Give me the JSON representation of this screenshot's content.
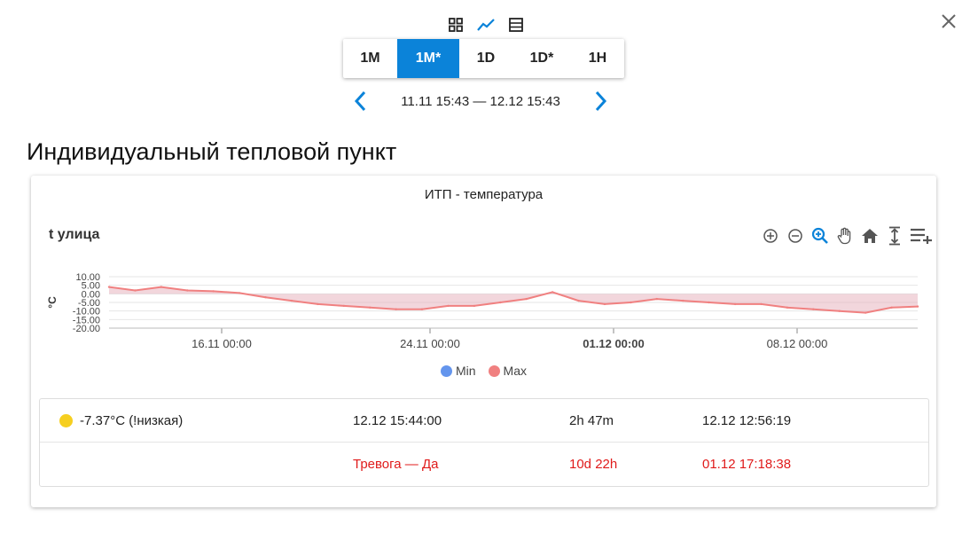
{
  "view_icons": [
    "grid-icon",
    "chart-line-icon",
    "table-icon"
  ],
  "colors": {
    "accent": "#0b83d9",
    "max_series": "#f08080",
    "min_series": "#6495ed",
    "alarm": "#e01b1b",
    "sun": "#f6cf20"
  },
  "period_tabs": [
    {
      "label": "1M",
      "active": false
    },
    {
      "label": "1M*",
      "active": true
    },
    {
      "label": "1D",
      "active": false
    },
    {
      "label": "1D*",
      "active": false
    },
    {
      "label": "1H",
      "active": false
    }
  ],
  "range": {
    "text": "11.11 15:43 — 12.12 15:43"
  },
  "section": {
    "title": "Индивидуальный тепловой пункт"
  },
  "chart": {
    "title": "ИТП - температура",
    "series_label": "t улица",
    "toolbar_icons": [
      "zoom-in-icon",
      "zoom-out-icon",
      "zoom-select-icon",
      "pan-hand-icon",
      "home-reset-icon",
      "autoscale-icon",
      "menu-add-icon"
    ],
    "legend": [
      {
        "name": "Min",
        "color": "#6495ed"
      },
      {
        "name": "Max",
        "color": "#f08080"
      }
    ]
  },
  "chart_data": {
    "type": "area",
    "ylabel": "°C",
    "ylim": [
      -20,
      10
    ],
    "y_ticks": [
      "10.00",
      "5.00",
      "0.00",
      "-5.00",
      "-10.00",
      "-15.00",
      "-20.00"
    ],
    "x_ticks": [
      "16.11 00:00",
      "24.11 00:00",
      "01.12 00:00",
      "08.12 00:00"
    ],
    "x_ticks_bold": [
      false,
      false,
      true,
      false
    ],
    "legend_placement": "bottom",
    "grid": true,
    "series": [
      {
        "name": "Max",
        "x": [
          "11.11",
          "12.11",
          "13.11",
          "14.11",
          "15.11",
          "16.11",
          "17.11",
          "18.11",
          "19.11",
          "20.11",
          "21.11",
          "22.11",
          "23.11",
          "24.11",
          "25.11",
          "26.11",
          "27.11",
          "28.11",
          "29.11",
          "30.11",
          "01.12",
          "02.12",
          "03.12",
          "04.12",
          "05.12",
          "06.12",
          "07.12",
          "08.12",
          "09.12",
          "10.12",
          "11.12",
          "12.12"
        ],
        "values": [
          4,
          2,
          4,
          2,
          1.5,
          0.5,
          -2,
          -4,
          -6,
          -7,
          -8,
          -9,
          -9,
          -7,
          -7,
          -5,
          -3,
          1,
          -4,
          -6,
          -5,
          -3,
          -4,
          -5,
          -6,
          -6,
          -8,
          -9,
          -10,
          -11,
          -8,
          -7.4
        ]
      }
    ]
  },
  "status": {
    "row1": {
      "value": "-7.37°C (!низкая)",
      "time": "12.12 15:44:00",
      "duration": "2h 47m",
      "since": "12.12 12:56:19"
    },
    "row2": {
      "alarm": "Тревога — Да",
      "duration": "10d 22h",
      "since": "01.12 17:18:38"
    }
  }
}
